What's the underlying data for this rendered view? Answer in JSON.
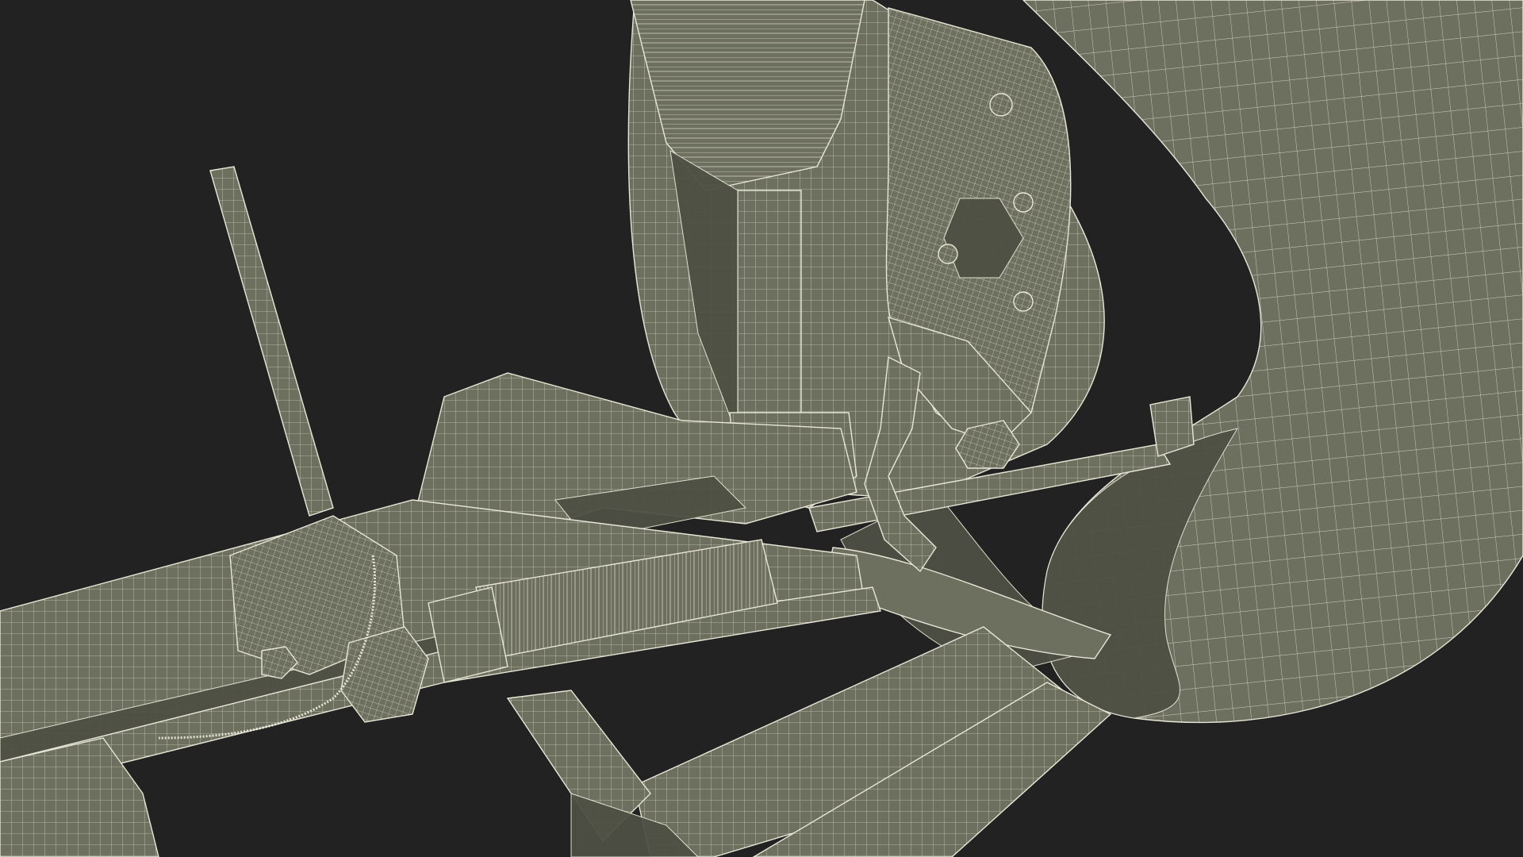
{
  "scene": {
    "background_color": "#222222",
    "mesh_fill_color": "#6e705f",
    "mesh_shadow_color": "#4e5044",
    "mesh_highlight_color": "#8a8c79",
    "wire_color": "#e8e6d6"
  }
}
